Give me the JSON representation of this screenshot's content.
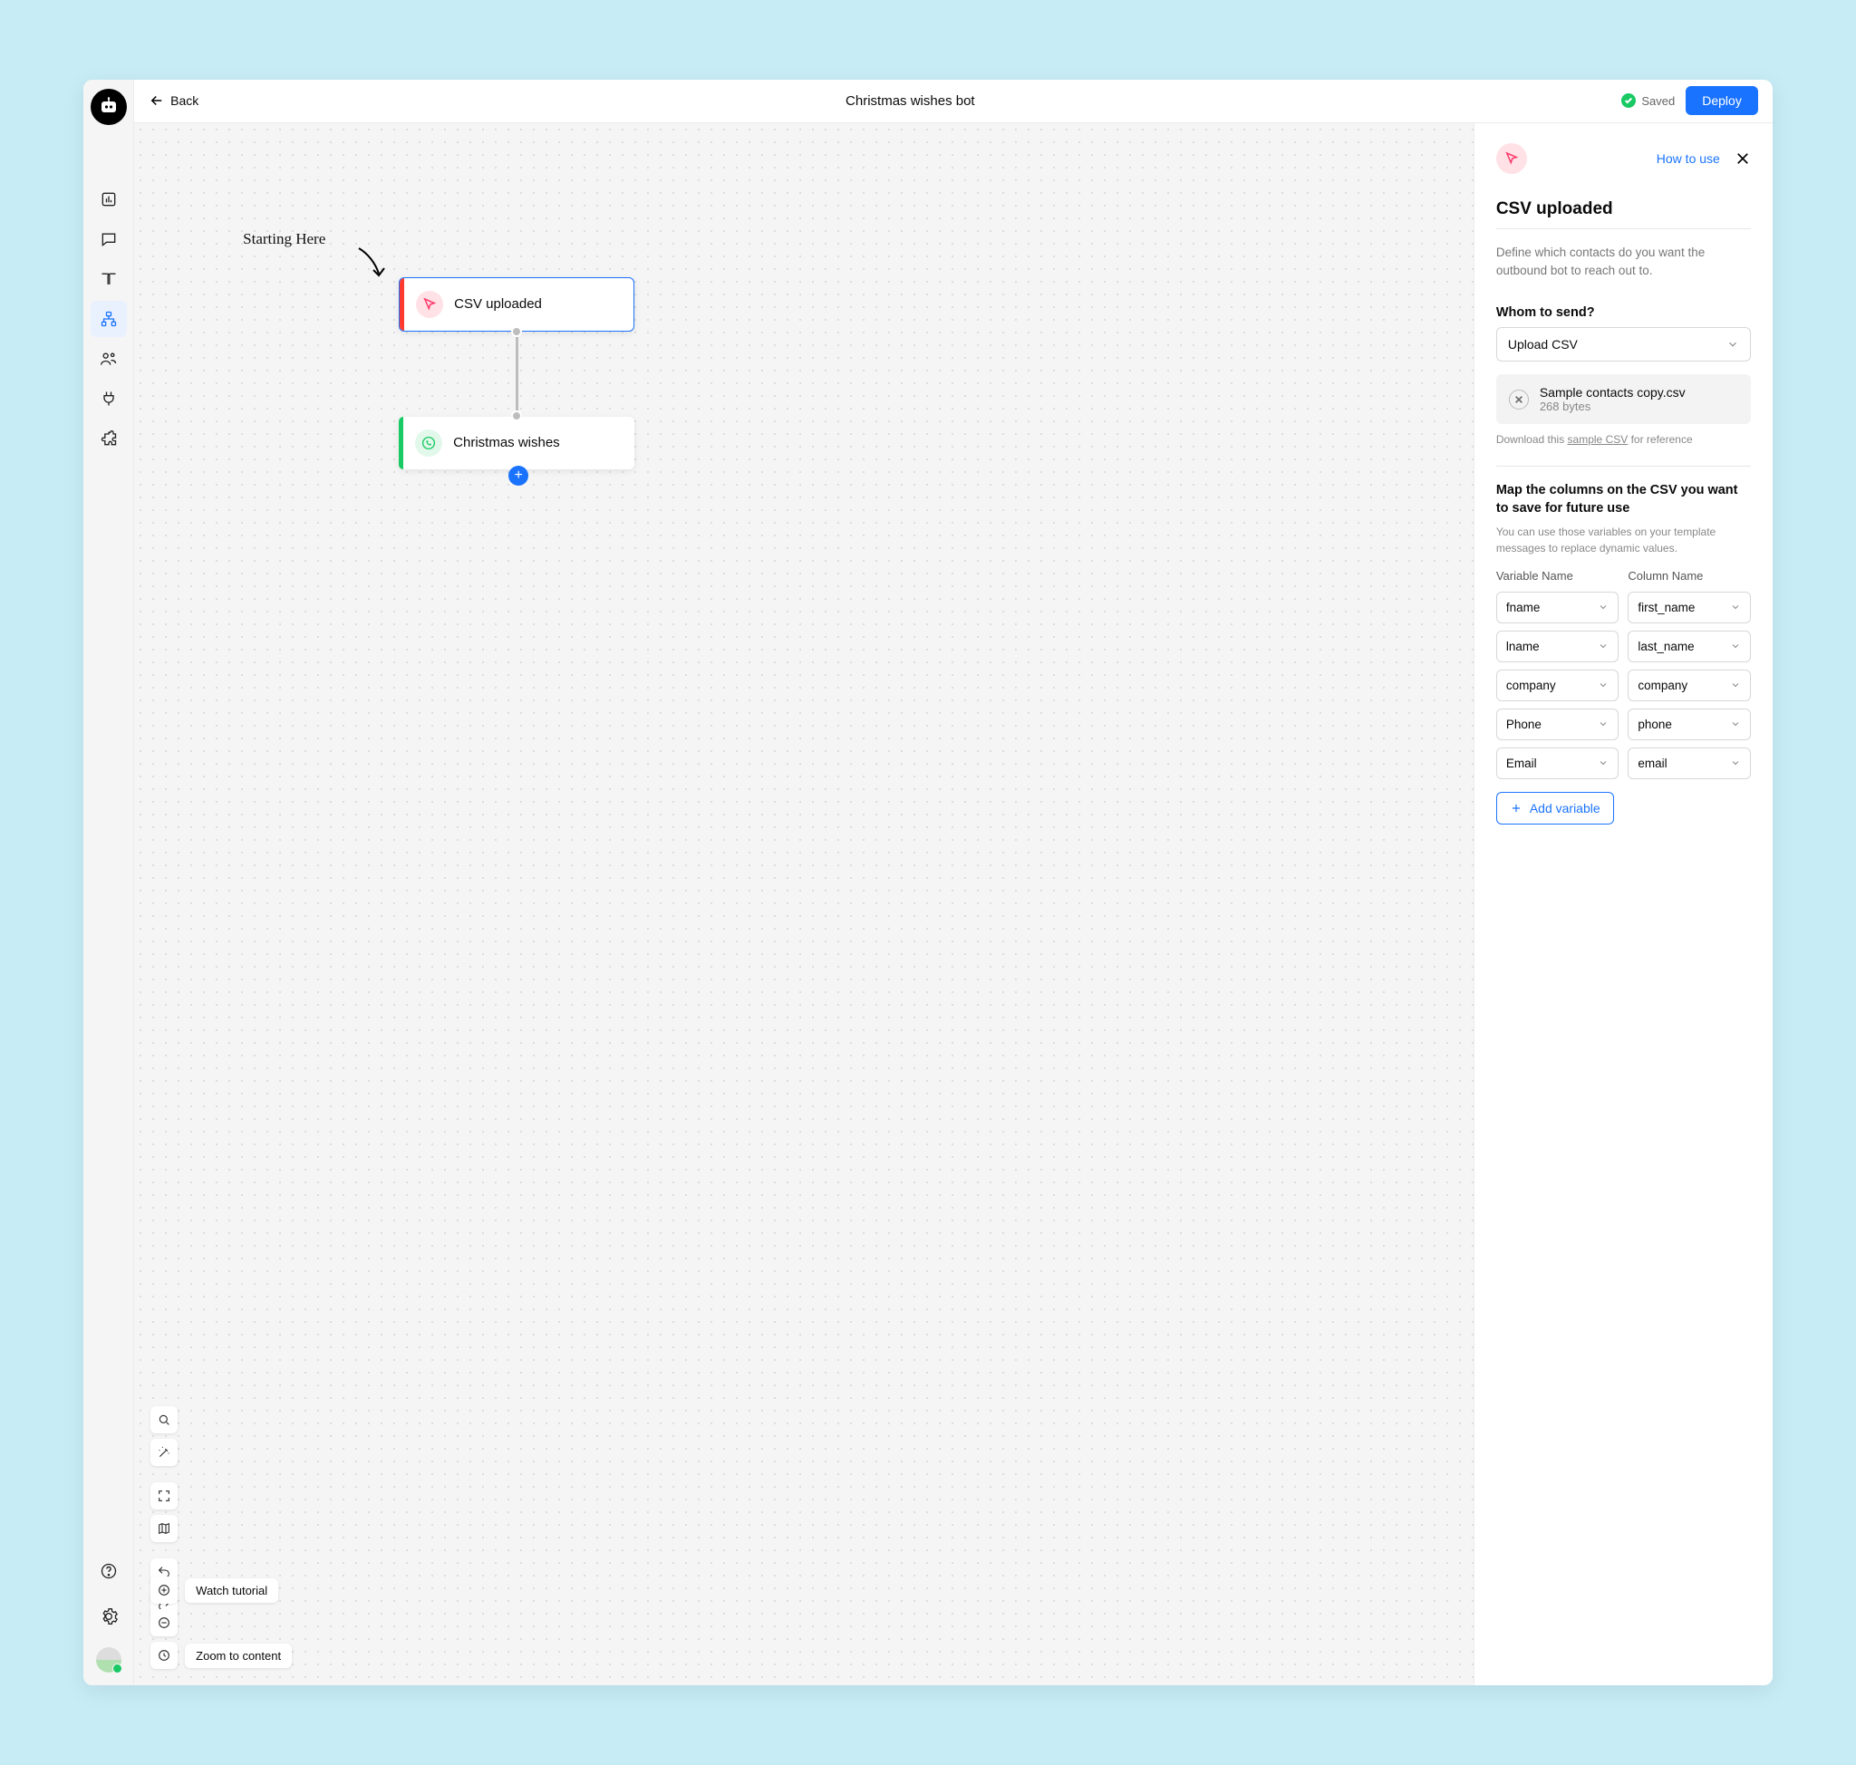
{
  "header": {
    "back": "Back",
    "title": "Christmas wishes bot",
    "saved": "Saved",
    "deploy": "Deploy"
  },
  "canvas": {
    "starting_note": "Starting Here",
    "node1_label": "CSV uploaded",
    "node2_label": "Christmas wishes"
  },
  "tools": {
    "watch_tutorial": "Watch tutorial",
    "zoom_to_content": "Zoom to content"
  },
  "panel": {
    "how_to_use": "How to use",
    "title": "CSV uploaded",
    "description": "Define which contacts do you want the outbound bot to reach out to.",
    "whom_to_send": "Whom to send?",
    "whom_value": "Upload CSV",
    "file_name": "Sample contacts copy.csv",
    "file_size": "268 bytes",
    "download_pre": "Download this ",
    "download_link": "sample CSV",
    "download_post": " for reference",
    "map_title": "Map the columns on the CSV you want to save for future use",
    "map_desc": "You can use those variables on your template messages to replace dynamic values.",
    "col_var": "Variable Name",
    "col_col": "Column Name",
    "rows": [
      {
        "var": "fname",
        "col": "first_name"
      },
      {
        "var": "lname",
        "col": "last_name"
      },
      {
        "var": "company",
        "col": "company"
      },
      {
        "var": "Phone",
        "col": "phone"
      },
      {
        "var": "Email",
        "col": "email"
      }
    ],
    "add_variable": "Add variable"
  }
}
